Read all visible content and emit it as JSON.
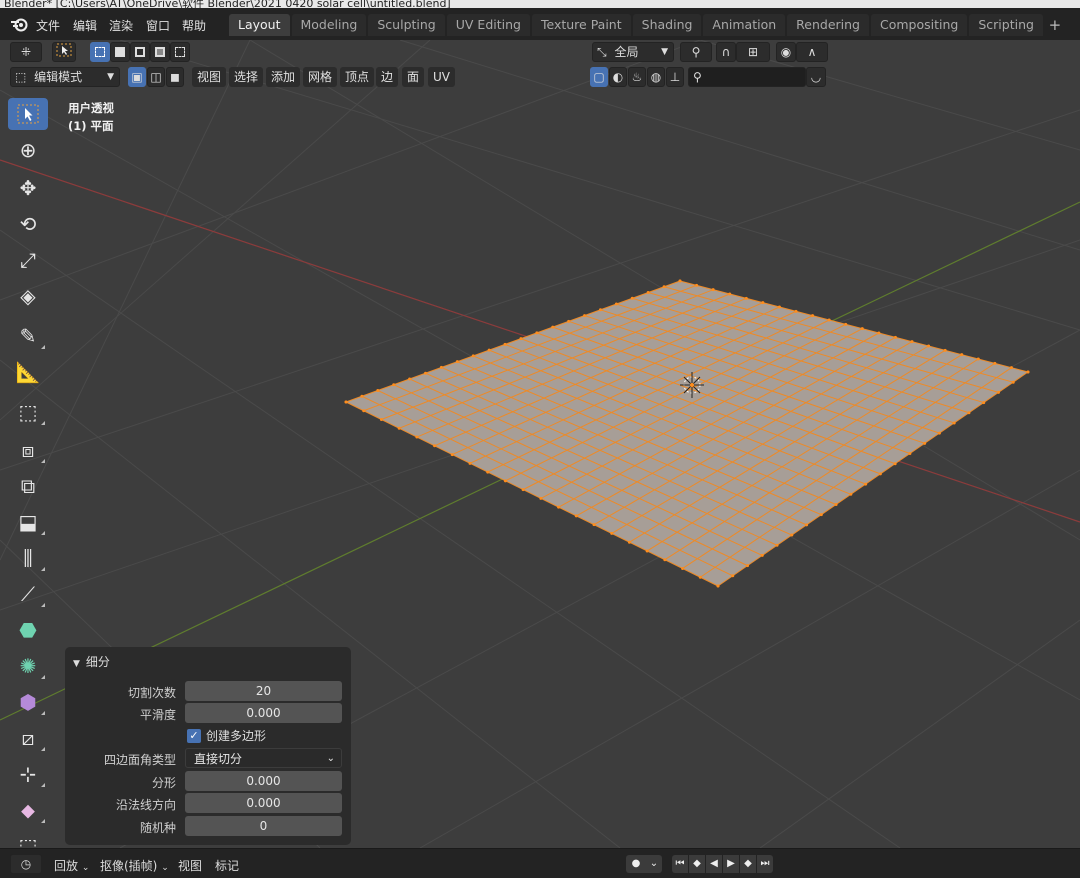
{
  "window": {
    "title": "Blender* [C:\\Users\\AT\\OneDrive\\软件 Blender\\2021 0420 solar cell\\untitled.blend]"
  },
  "menu": {
    "file": "文件",
    "edit": "编辑",
    "render": "渲染",
    "window": "窗口",
    "help": "帮助"
  },
  "workspaces": [
    {
      "label": "Layout",
      "active": true
    },
    {
      "label": "Modeling"
    },
    {
      "label": "Sculpting"
    },
    {
      "label": "UV Editing"
    },
    {
      "label": "Texture Paint"
    },
    {
      "label": "Shading"
    },
    {
      "label": "Animation"
    },
    {
      "label": "Rendering"
    },
    {
      "label": "Compositing"
    },
    {
      "label": "Scripting"
    }
  ],
  "workspace_add": "+",
  "header": {
    "transform_orientation": "全局",
    "mode": "编辑模式",
    "menus": {
      "view": "视图",
      "select": "选择",
      "add": "添加",
      "mesh": "网格",
      "vertex": "顶点",
      "edge": "边",
      "face": "面",
      "uv": "UV"
    },
    "search_placeholder": ""
  },
  "viewport": {
    "view_name": "用户透视",
    "object_name": "(1) 平面",
    "grid_subdivisions": 20
  },
  "operator_panel": {
    "title": "细分",
    "number_of_cuts": {
      "label": "切割次数",
      "value": "20"
    },
    "smoothness": {
      "label": "平滑度",
      "value": "0.000"
    },
    "create_ngons": {
      "label": "创建多边形",
      "checked": true
    },
    "quad_corner_type": {
      "label": "四边面角类型",
      "value": "直接切分"
    },
    "fractal": {
      "label": "分形",
      "value": "0.000"
    },
    "along_normal": {
      "label": "沿法线方向",
      "value": "0.000"
    },
    "random_seed": {
      "label": "随机种",
      "value": "0"
    }
  },
  "timeline": {
    "playback": "回放",
    "keying": "抠像(插帧)",
    "view": "视图",
    "marker": "标记"
  },
  "colors": {
    "accent": "#4772b3",
    "mesh_face": "#a79e97",
    "mesh_edge": "#f28f2a",
    "x_axis": "#a04040",
    "y_axis": "#6d8a36"
  }
}
